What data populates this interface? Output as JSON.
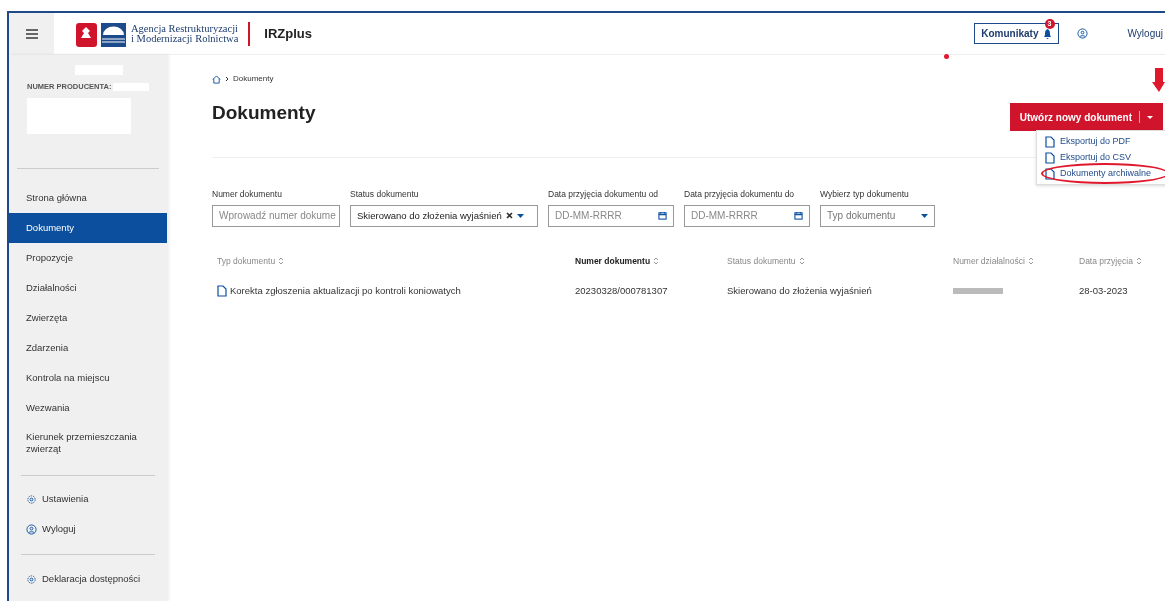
{
  "header": {
    "agency_name": [
      "Agencja Restrukturyzacji",
      "i Modernizacji Rolnictwa"
    ],
    "app_name": "IRZplus",
    "messages_button": "Komunikaty",
    "messages_badge": "3",
    "logout": "Wyloguj"
  },
  "sidebar": {
    "producer_label": "NUMER PRODUCENTA:",
    "items": [
      {
        "label": "Strona główna",
        "selected": false
      },
      {
        "label": "Dokumenty",
        "selected": true
      },
      {
        "label": "Propozycje",
        "selected": false
      },
      {
        "label": "Działalności",
        "selected": false
      },
      {
        "label": "Zwierzęta",
        "selected": false
      },
      {
        "label": "Zdarzenia",
        "selected": false
      },
      {
        "label": "Kontrola na miejscu",
        "selected": false
      },
      {
        "label": "Wezwania",
        "selected": false
      },
      {
        "label": "Kierunek przemieszczania zwierząt",
        "selected": false
      }
    ],
    "settings": [
      {
        "label": "Ustawienia",
        "kind": "gear"
      },
      {
        "label": "Wyloguj",
        "kind": "user"
      }
    ],
    "footer": {
      "label": "Deklaracja dostępności",
      "kind": "gear"
    }
  },
  "breadcrumb": "Dokumenty",
  "title": "Dokumenty",
  "create_button": "Utwórz nowy dokument",
  "menu": [
    {
      "label": "Eksportuj do PDF",
      "highlighted": false
    },
    {
      "label": "Eksportuj do CSV",
      "highlighted": false
    },
    {
      "label": "Dokumenty archiwalne",
      "highlighted": true
    }
  ],
  "filters": [
    {
      "label": "Numer dokumentu",
      "kind": "text",
      "placeholder": "Wprowadź numer dokume"
    },
    {
      "label": "Status dokumentu",
      "kind": "select",
      "value": "Skierowano do złożenia wyjaśnień"
    },
    {
      "label": "Data przyjęcia dokumentu od",
      "kind": "date",
      "placeholder": "DD-MM-RRRR"
    },
    {
      "label": "Data przyjęcia dokumentu do",
      "kind": "date",
      "placeholder": "DD-MM-RRRR"
    },
    {
      "label": "Wybierz typ dokumentu",
      "kind": "dropdown",
      "placeholder": "Typ dokumentu"
    }
  ],
  "table": {
    "columns": [
      {
        "label": "Typ dokumentu",
        "selected": false
      },
      {
        "label": "Numer dokumentu",
        "selected": true
      },
      {
        "label": "Status dokumentu",
        "selected": false
      },
      {
        "label": "Numer działalności",
        "selected": false
      },
      {
        "label": "Data przyjęcia",
        "selected": false
      }
    ],
    "rows": [
      {
        "type": "Korekta zgłoszenia aktualizacji po kontroli koniowatych",
        "number": "20230328/000781307",
        "status": "Skierowano do złożenia wyjaśnień",
        "date": "28-03-2023"
      }
    ]
  }
}
